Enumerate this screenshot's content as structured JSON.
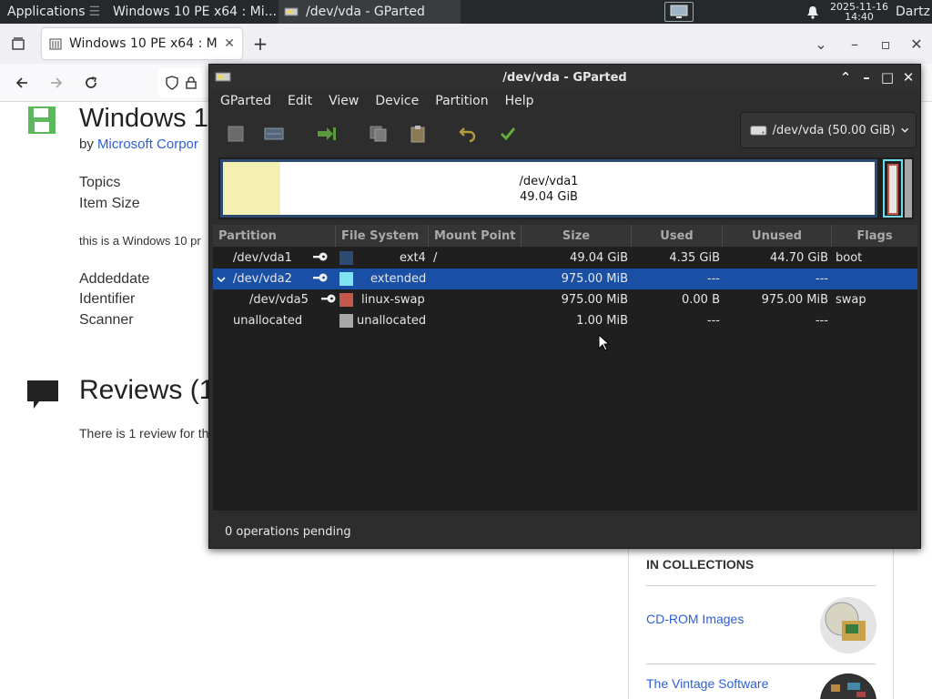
{
  "panel": {
    "applications_label": "Applications",
    "tasks": [
      {
        "label": "Windows 10 PE x64 : Mi..."
      },
      {
        "label": "/dev/vda - GParted"
      }
    ],
    "clock_date": "2025-11-16",
    "clock_time": "14:40",
    "user": "Dartz"
  },
  "firefox": {
    "tab_title": "Windows 10 PE x64 : Mi",
    "new_tab": "+"
  },
  "webpage": {
    "title": "Windows 1",
    "by_prefix": "by ",
    "author": "Microsoft Corpor",
    "meta_labels": [
      "Topics",
      "Item Size"
    ],
    "description": "this is a Windows 10 pr",
    "meta_labels2": [
      "Addeddate",
      "Identifier",
      "Scanner"
    ],
    "reviews_title": "Reviews (1",
    "review_text": "There is 1 review for th",
    "collections": {
      "header": "IN COLLECTIONS",
      "items": [
        "CD-ROM Images",
        "The Vintage Software"
      ]
    }
  },
  "gparted": {
    "window_title": "/dev/vda - GParted",
    "menu": [
      "GParted",
      "Edit",
      "View",
      "Device",
      "Partition",
      "Help"
    ],
    "device_selector": "/dev/vda (50.00 GiB)",
    "map": {
      "name": "/dev/vda1",
      "size": "49.04 GiB"
    },
    "columns": [
      "Partition",
      "File System",
      "Mount Point",
      "Size",
      "Used",
      "Unused",
      "Flags"
    ],
    "rows": [
      {
        "partition": "/dev/vda1",
        "filesystem": "ext4",
        "mount": "/",
        "size": "49.04 GiB",
        "used": "4.35 GiB",
        "unused": "44.70 GiB",
        "flags": "boot",
        "color": "#2c4a72"
      },
      {
        "partition": "/dev/vda2",
        "filesystem": "extended",
        "mount": "",
        "size": "975.00 MiB",
        "used": "---",
        "unused": "---",
        "flags": "",
        "color": "#7fe3f2"
      },
      {
        "partition": "/dev/vda5",
        "filesystem": "linux-swap",
        "mount": "",
        "size": "975.00 MiB",
        "used": "0.00 B",
        "unused": "975.00 MiB",
        "flags": "swap",
        "color": "#c4584a"
      },
      {
        "partition": "unallocated",
        "filesystem": "unallocated",
        "mount": "",
        "size": "1.00 MiB",
        "used": "---",
        "unused": "---",
        "flags": "",
        "color": "#a8a8a8"
      }
    ],
    "status": "0 operations pending"
  }
}
